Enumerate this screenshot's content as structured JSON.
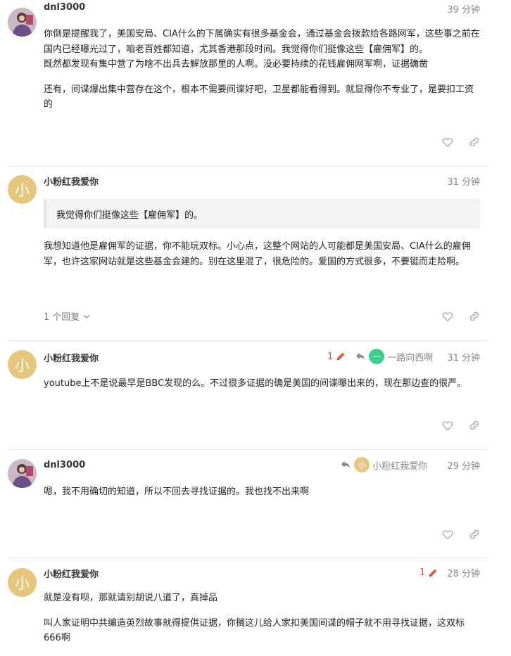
{
  "colors": {
    "accent_edit": "#e45735",
    "avatar_letter_bg": "#e5c67d",
    "avatar_green": "#3ecf8e",
    "muted": "#888888"
  },
  "posts": [
    {
      "username": "dnl3000",
      "time": "39 分钟",
      "avatar": "photo",
      "paragraphs": [
        "你倒是提醒我了，美国安局、CIA什么的下属确实有很多基金会，通过基金会拨款给各路网军，这些事之前在国内已经曝光过了，咱老百姓都知道，尤其香港那段时间。我觉得你们挺像这些【雇佣军】的。",
        "既然都发现有集中营了为啥不出兵去解放那里的人啊。没必要持续的花钱雇佣网军啊，证据确凿",
        "还有，间谍爆出集中营存在这个，根本不需要间谍好吧，卫星都能看得到。就显得你不专业了，是要扣工资的"
      ]
    },
    {
      "username": "小粉红我爱你",
      "time": "31 分钟",
      "avatar_letter": "小",
      "quote": "我觉得你们挺像这些【雇佣军】的。",
      "paragraphs": [
        "我想知道他是雇佣军的证据，你不能玩双标。小心点，这整个网站的人可能都是美国安局、CIA什么的雇佣军，也许这家网站就是这些基金会建的。别在这里混了，很危险的。爱国的方式很多，不要铤而走险啊。"
      ],
      "replies_label": "1 个回复"
    },
    {
      "username": "小粉红我爱你",
      "time": "31 分钟",
      "avatar_letter": "小",
      "edit_count": "1",
      "reply_to_name": "一路向西啊",
      "reply_to_avatar": "一",
      "paragraphs": [
        "youtube上不是说最早是BBC发现的么。不过很多证据的确是美国的间谍曝出来的，现在那边查的很严。"
      ]
    },
    {
      "username": "dnl3000",
      "time": "29 分钟",
      "avatar": "photo",
      "reply_to_name": "小粉红我爱你",
      "reply_to_avatar": "小",
      "paragraphs": [
        "嗯，我不用确切的知道，所以不回去寻找证据的。我也找不出来啊"
      ]
    },
    {
      "username": "小粉红我爱你",
      "time": "28 分钟",
      "avatar_letter": "小",
      "edit_count": "1",
      "paragraphs": [
        "就是没有呗，那就请别胡说八道了，真掉品",
        "叫人家证明中共编造英烈故事就得提供证据，你搁这儿给人家扣美国间谍的帽子就不用寻找证据，这双标666啊"
      ]
    }
  ]
}
